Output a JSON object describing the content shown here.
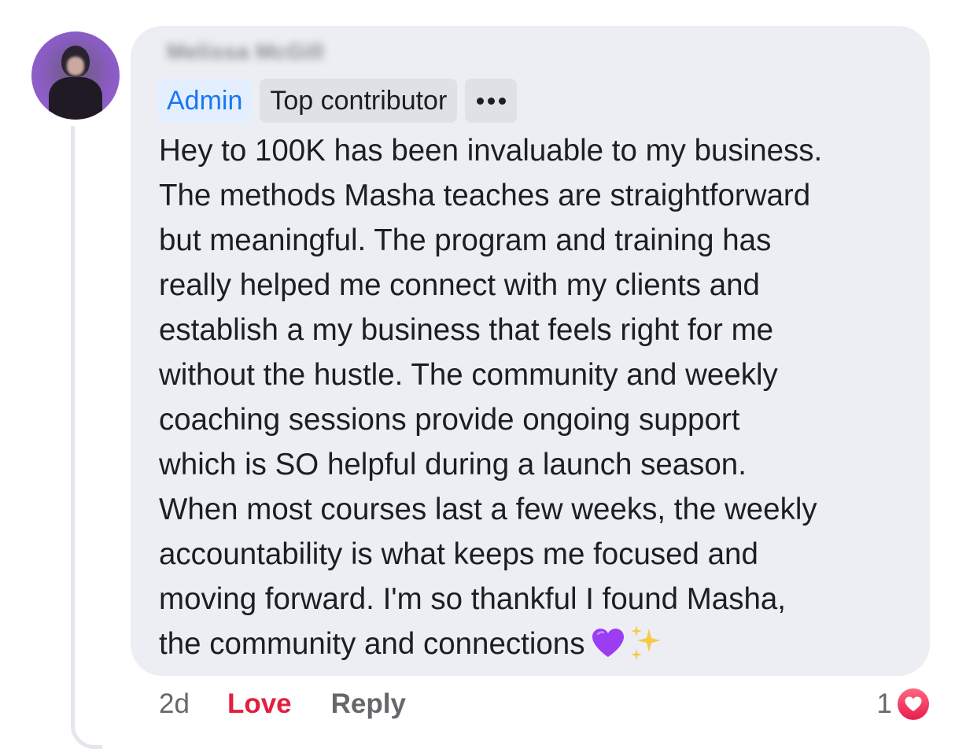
{
  "comment": {
    "author": "Melissa McGill",
    "badges": {
      "admin": "Admin",
      "top_contributor": "Top contributor"
    },
    "lines": [
      "Hey to 100K has been invaluable to my business.",
      "The methods Masha teaches are straightforward",
      "but meaningful. The program and training has",
      "really helped me connect with my clients and",
      "establish a my business that feels right for me",
      "without the hustle. The community and weekly",
      "coaching sessions provide ongoing support",
      "which is SO helpful during a launch season.",
      "When most courses last a few weeks, the weekly",
      "accountability is what keeps me focused and",
      "moving forward. I'm so thankful I found Masha,",
      "the community and connections"
    ],
    "emojis": [
      "purple-heart",
      "sparkles"
    ]
  },
  "actions": {
    "time": "2d",
    "love": "Love",
    "reply": "Reply"
  },
  "reactions": {
    "count": "1",
    "icon": "love-reaction-icon"
  },
  "colors": {
    "bubble": "#eceef3",
    "admin_text": "#1877f2",
    "love_text": "#e41e3f",
    "muted_text": "#65676b"
  }
}
